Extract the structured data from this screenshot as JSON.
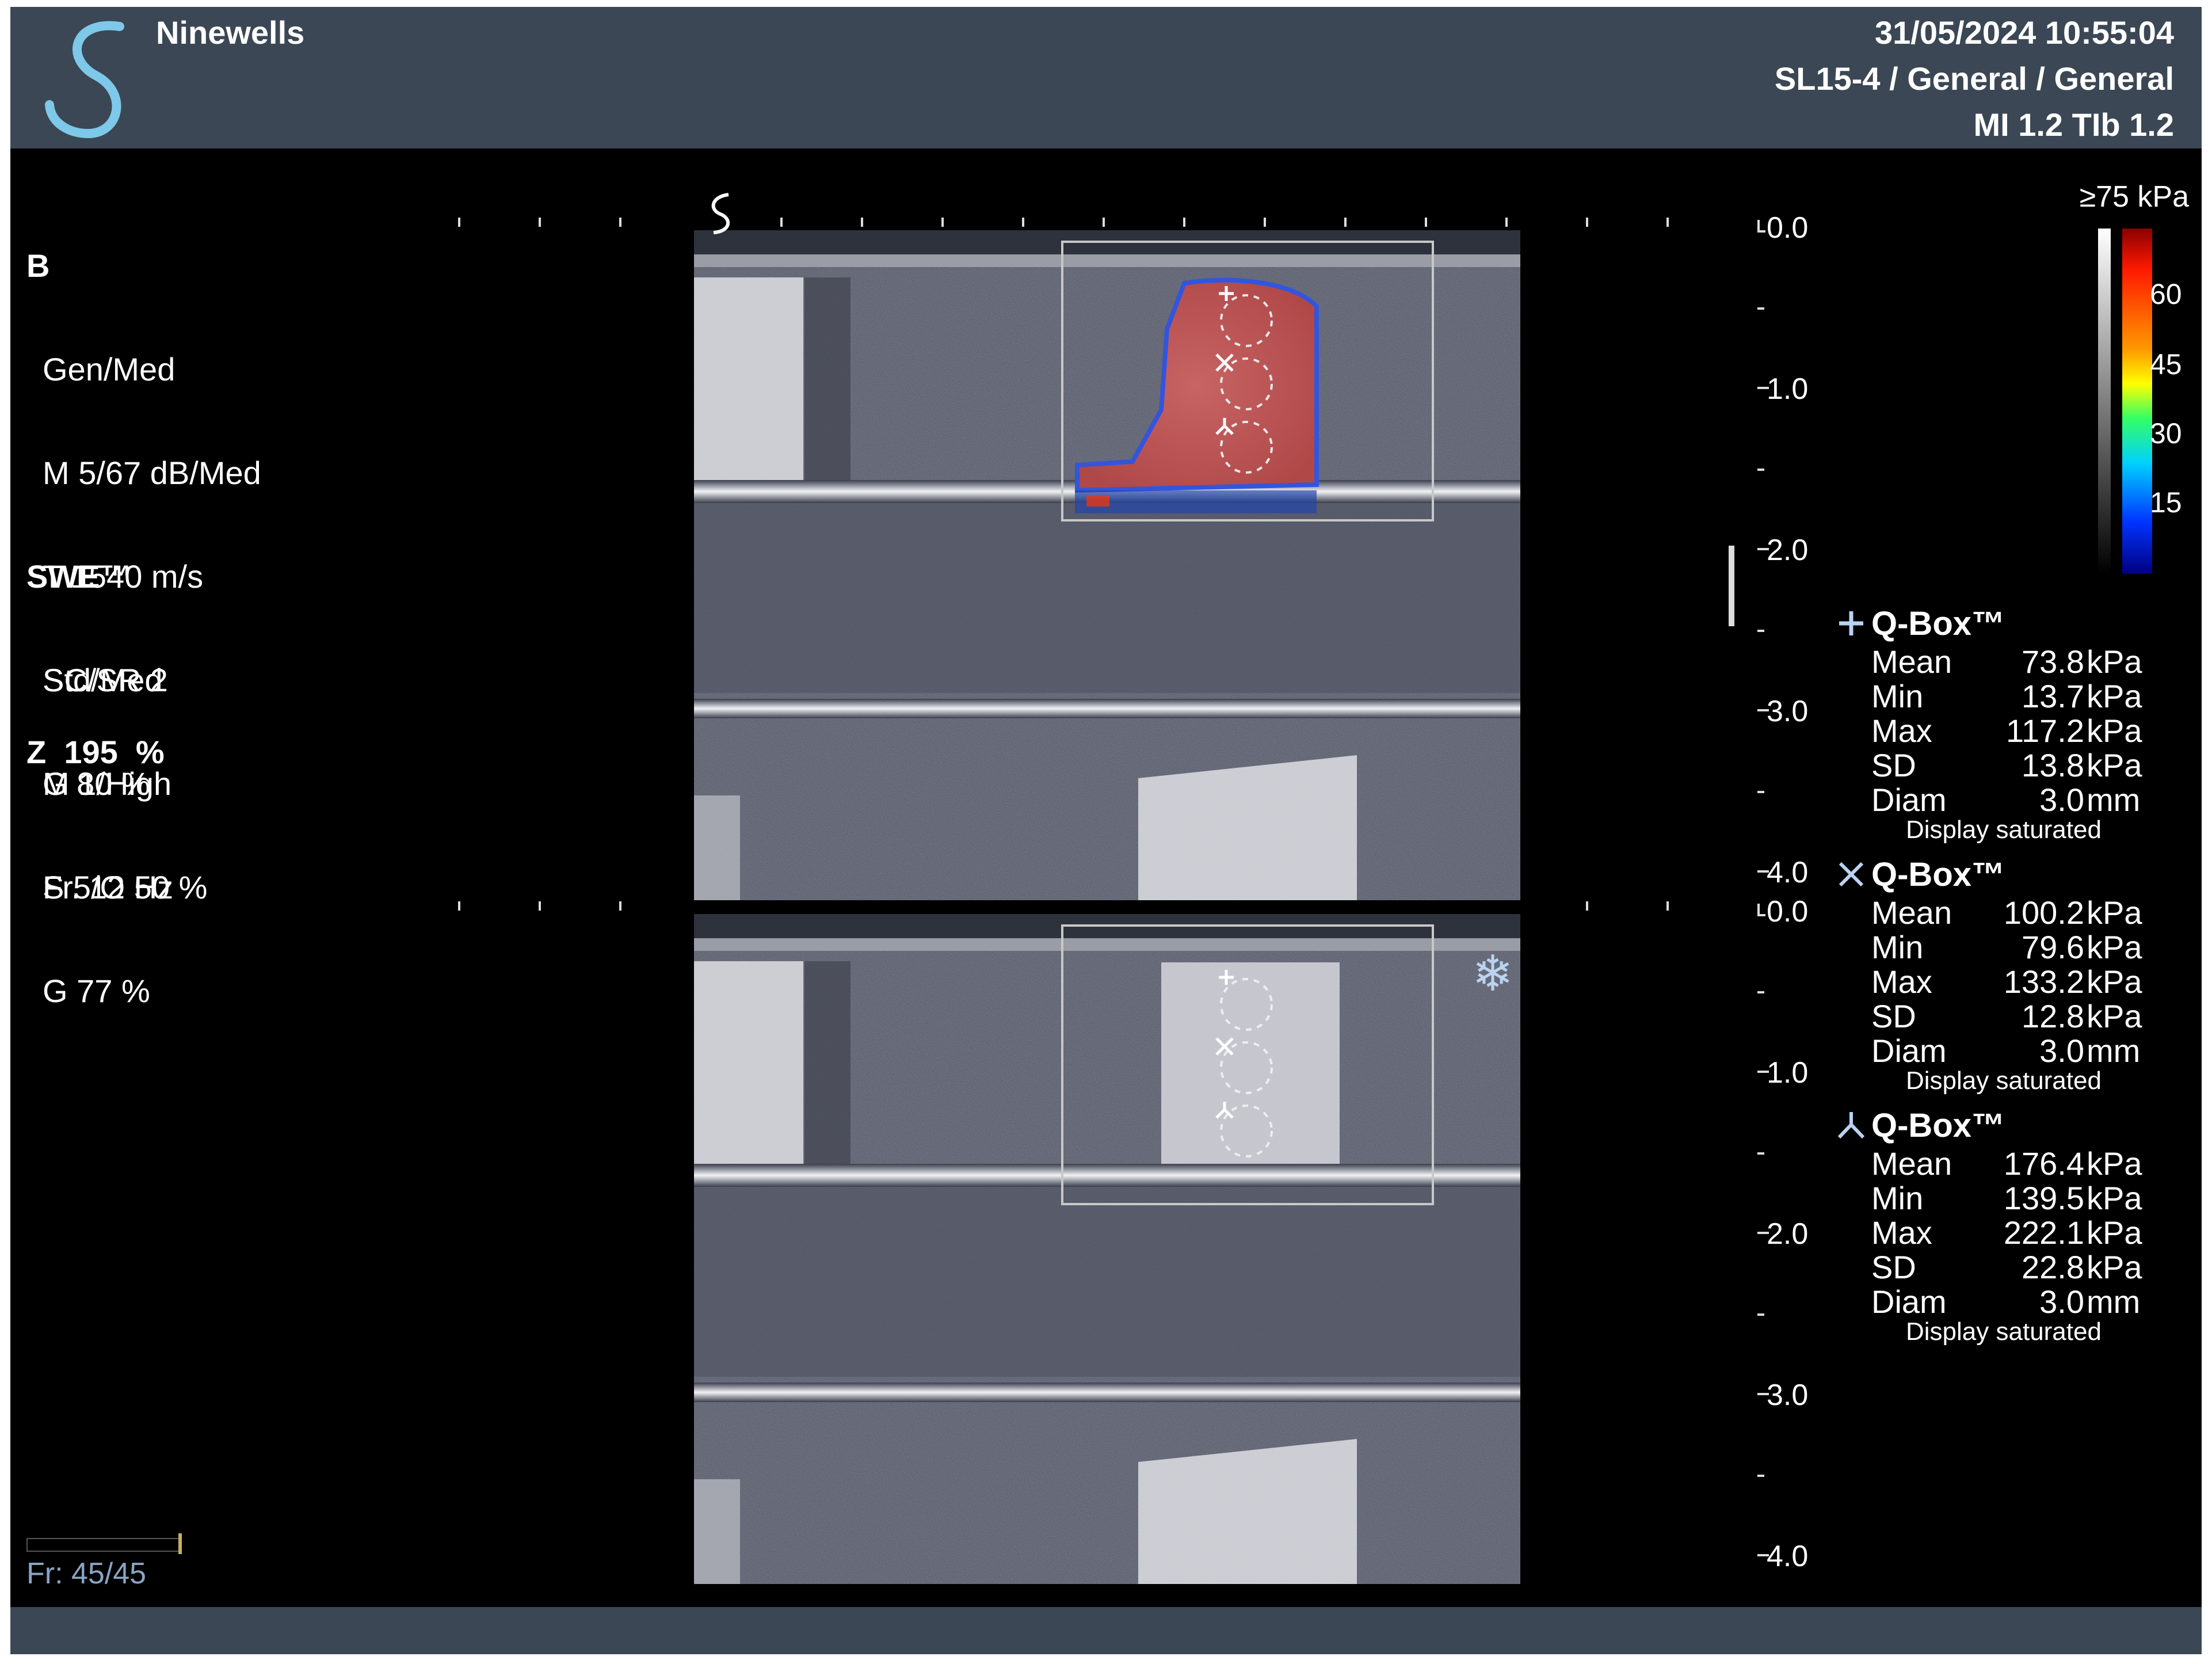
{
  "header": {
    "site_name": "Ninewells",
    "datetime": "31/05/2024 10:55:04",
    "probe_preset": "SL15-4 / General / General",
    "mi_tib": "MI 1.2  TIb 1.2",
    "logo_icon": "supersonic-s-logo"
  },
  "b_mode": {
    "title": "B",
    "lines": [
      "Gen/Med",
      "M 5/67 dB/Med",
      "T 1540 m/s",
      "SC/SR 2",
      "G 80 %",
      "Fr. 12 Hz"
    ]
  },
  "swe": {
    "title": "SWE™",
    "lines": [
      "Std/Med",
      "M 1/High",
      "S 5/O 50 %",
      "G 77 %"
    ]
  },
  "zoom": "Z  195  %",
  "frame_counter": {
    "label": "Fr: 45/45",
    "progress": 1.0
  },
  "depth_scale": {
    "unit_marker": "L",
    "upper": [
      "0.0",
      "1.0",
      "2.0",
      "3.0",
      "4.0"
    ],
    "lower": [
      "0.0",
      "1.0",
      "2.0",
      "3.0",
      "4.0"
    ]
  },
  "colorbar": {
    "max_label": "≥75 kPa",
    "labels": [
      "60",
      "45",
      "30",
      "15"
    ],
    "colors": [
      "#8b0000",
      "#ff0000",
      "#ff9900",
      "#ffff00",
      "#00ff66",
      "#00ccff",
      "#0033ff",
      "#000066"
    ]
  },
  "qboxes": [
    {
      "icon": "plus-icon",
      "title": "Q-Box™",
      "mean": "73.8",
      "min": "13.7",
      "max": "117.2",
      "sd": "13.8",
      "diam": "3.0",
      "note": "Display saturated"
    },
    {
      "icon": "cross-icon",
      "title": "Q-Box™",
      "mean": "100.2",
      "min": "79.6",
      "max": "133.2",
      "sd": "12.8",
      "diam": "3.0",
      "note": "Display saturated"
    },
    {
      "icon": "tripod-icon",
      "title": "Q-Box™",
      "mean": "176.4",
      "min": "139.5",
      "max": "222.1",
      "sd": "22.8",
      "diam": "3.0",
      "note": "Display saturated"
    }
  ],
  "labels": {
    "mean": "Mean",
    "min": "Min",
    "max": "Max",
    "sd": "SD",
    "diam": "Diam",
    "kpa": "kPa",
    "mm": "mm"
  },
  "freeze_icon": "snowflake-icon",
  "freeze_glyph": "❄"
}
